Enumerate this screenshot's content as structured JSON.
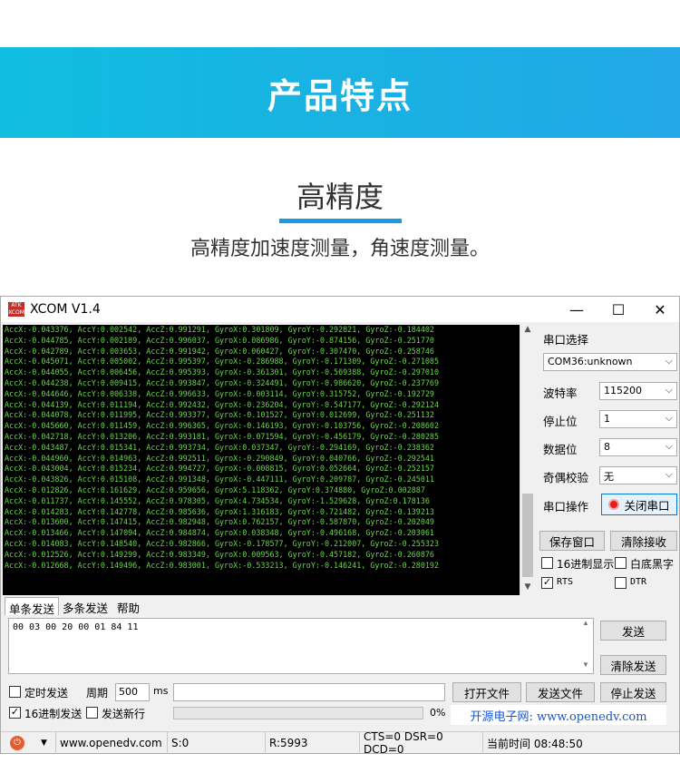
{
  "banner": {
    "title": "产品特点"
  },
  "section": {
    "title": "高精度",
    "subtitle": "高精度加速度测量，角速度测量。"
  },
  "window": {
    "logo": "ATK XCOM",
    "title": "XCOM V1.4",
    "minimize": "—",
    "maximize": "☐",
    "close": "✕"
  },
  "console": {
    "lines": [
      "AccX:-0.043376, AccY:0.002542, AccZ:0.991291, GyroX:0.301809, GyroY:-0.292821, GyroZ:-0.184402",
      "AccX:-0.044785, AccY:0.002189, AccZ:0.996037, GyroX:0.086986, GyroY:-0.874156, GyroZ:-0.251770",
      "AccX:-0.042789, AccY:0.003653, AccZ:0.991942, GyroX:0.060427, GyroY:-0.307470, GyroZ:-0.258746",
      "AccX:-0.045071, AccY:0.005002, AccZ:0.995397, GyroX:-0.286988, GyroY:-0.171309, GyroZ:-0.271085",
      "AccX:-0.044055, AccY:0.006456, AccZ:0.995393, GyroX:-0.361301, GyroY:-0.569388, GyroZ:-0.297010",
      "AccX:-0.044238, AccY:0.009415, AccZ:0.993847, GyroX:-0.324491, GyroY:-0.986620, GyroZ:-0.237769",
      "AccX:-0.044646, AccY:0.006338, AccZ:0.996633, GyroX:-0.003114, GyroY:0.315752, GyroZ:-0.192729",
      "AccX:-0.044139, AccY:0.011194, AccZ:0.992432, GyroX:-0.236204, GyroY:-0.547177, GyroZ:-0.292124",
      "AccX:-0.044078, AccY:0.011995, AccZ:0.993377, GyroX:-0.101527, GyroY:0.012699, GyroZ:-0.251132",
      "AccX:-0.045660, AccY:0.011459, AccZ:0.996365, GyroX:-0.146193, GyroY:-0.103756, GyroZ:-0.208602",
      "AccX:-0.042718, AccY:0.013206, AccZ:0.993181, GyroX:-0.071594, GyroY:-0.456179, GyroZ:-0.280285",
      "AccX:-0.043487, AccY:0.015341, AccZ:0.993734, GyroX:0.037347, GyroY:-0.294169, GyroZ:-0.238362",
      "AccX:-0.044960, AccY:0.014963, AccZ:0.992511, GyroX:-0.290849, GyroY:0.040766, GyroZ:-0.292541",
      "AccX:-0.043004, AccY:0.015234, AccZ:0.994727, GyroX:-0.008815, GyroY:0.052664, GyroZ:-0.252157",
      "AccX:-0.043826, AccY:0.015108, AccZ:0.991348, GyroX:-0.447111, GyroY:0.209787, GyroZ:-0.245011",
      "AccX:-0.012826, AccY:0.161629, AccZ:0.959656, GyroX:5.118362, GyroY:0.374880, GyroZ:0.002887",
      "AccX:-0.011737, AccY:0.145552, AccZ:0.978305, GyroX:4.734534, GyroY:-1.529628, GyroZ:0.178136",
      "AccX:-0.014283, AccY:0.142778, AccZ:0.985636, GyroX:1.316183, GyroY:-0.721482, GyroZ:-0.139213",
      "AccX:-0.013600, AccY:0.147415, AccZ:0.982948, GyroX:0.762157, GyroY:-0.587870, GyroZ:-0.202049",
      "AccX:-0.013466, AccY:0.147094, AccZ:0.984874, GyroX:0.038348, GyroY:-0.496168, GyroZ:-0.203061",
      "AccX:-0.014083, AccY:0.148540, AccZ:0.982866, GyroX:-0.178577, GyroY:-0.212007, GyroZ:-0.255323",
      "AccX:-0.012526, AccY:0.149299, AccZ:0.983349, GyroX:0.009563, GyroY:-0.457182, GyroZ:-0.260876",
      "AccX:-0.012668, AccY:0.149496, AccZ:0.983001, GyroX:-0.533213, GyroY:-0.146241, GyroZ:-0.280192"
    ]
  },
  "panel": {
    "port_label": "串口选择",
    "port_value": "COM36:unknown",
    "baud_label": "波特率",
    "baud_value": "115200",
    "stop_label": "停止位",
    "stop_value": "1",
    "data_label": "数据位",
    "data_value": "8",
    "parity_label": "奇偶校验",
    "parity_value": "无",
    "op_label": "串口操作",
    "op_button": "关闭串口",
    "save_window": "保存窗口",
    "clear_receive": "清除接收",
    "hex_display": "16进制显示",
    "white_black": "白底黑字",
    "rts": "RTS",
    "dtr": "DTR"
  },
  "tabs": [
    "单条发送",
    "多条发送",
    "帮助"
  ],
  "send": {
    "text": "00 03 00 20 00 01 84 11",
    "send_button": "发送",
    "clear_send": "清除发送",
    "timed_send": "定时发送",
    "period_label": "周期",
    "period_value": "500",
    "period_unit": "ms",
    "open_file": "打开文件",
    "send_file": "发送文件",
    "stop_send": "停止发送",
    "hex_send": "16进制发送",
    "newline": "发送新行",
    "progress": "0%",
    "progress_value": 0,
    "site_text": "开源电子网: www.openedv.com"
  },
  "status": {
    "url": "www.openedv.com",
    "sent": "S:0",
    "received": "R:5993",
    "signals": "CTS=0 DSR=0 DCD=0",
    "time": "当前时间 08:48:50"
  },
  "colors": {
    "banner": "#10bde0",
    "accent": "#1a9ae0",
    "console_text": "#68d64a",
    "console_bg": "#000000"
  }
}
